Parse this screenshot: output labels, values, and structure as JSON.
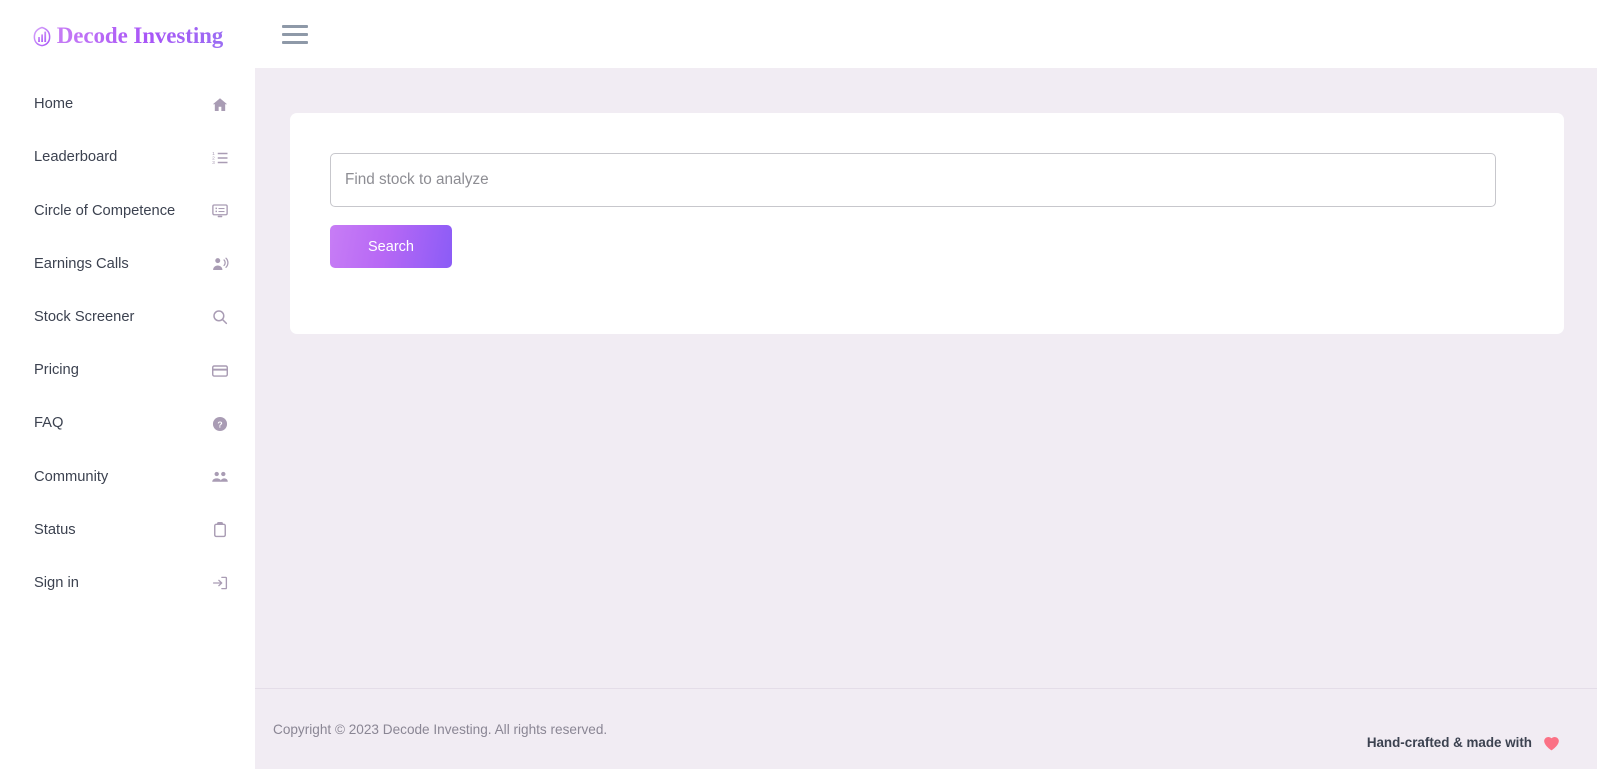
{
  "brand": {
    "name": "Decode Investing",
    "icon": "chart-circle-icon",
    "gradient_from": "#c77df5",
    "gradient_to": "#9b6ef3"
  },
  "topbar": {
    "menu_toggle": "hamburger-menu-icon"
  },
  "sidebar": {
    "items": [
      {
        "label": "Home",
        "icon": "home-icon"
      },
      {
        "label": "Leaderboard",
        "icon": "ordered-list-icon"
      },
      {
        "label": "Circle of Competence",
        "icon": "monitor-icon"
      },
      {
        "label": "Earnings Calls",
        "icon": "person-voice-icon"
      },
      {
        "label": "Stock Screener",
        "icon": "search-icon"
      },
      {
        "label": "Pricing",
        "icon": "credit-card-icon"
      },
      {
        "label": "FAQ",
        "icon": "help-circle-icon"
      },
      {
        "label": "Community",
        "icon": "people-icon"
      },
      {
        "label": "Status",
        "icon": "clipboard-icon"
      },
      {
        "label": "Sign in",
        "icon": "login-arrow-icon"
      }
    ],
    "icon_color": "#a99cb4"
  },
  "main": {
    "search": {
      "placeholder": "Find stock to analyze",
      "value": "",
      "button_label": "Search",
      "button_gradient_from": "#c77df5",
      "button_gradient_to": "#8b5cf6"
    },
    "background_color": "#f1ecf3",
    "card_background": "#ffffff"
  },
  "footer": {
    "copyright": "Copyright © 2023 Decode Investing. All rights reserved.",
    "handcrafted_text": "Hand-crafted & made with",
    "heart_icon": "heart-icon",
    "heart_color": "#fb7185"
  }
}
